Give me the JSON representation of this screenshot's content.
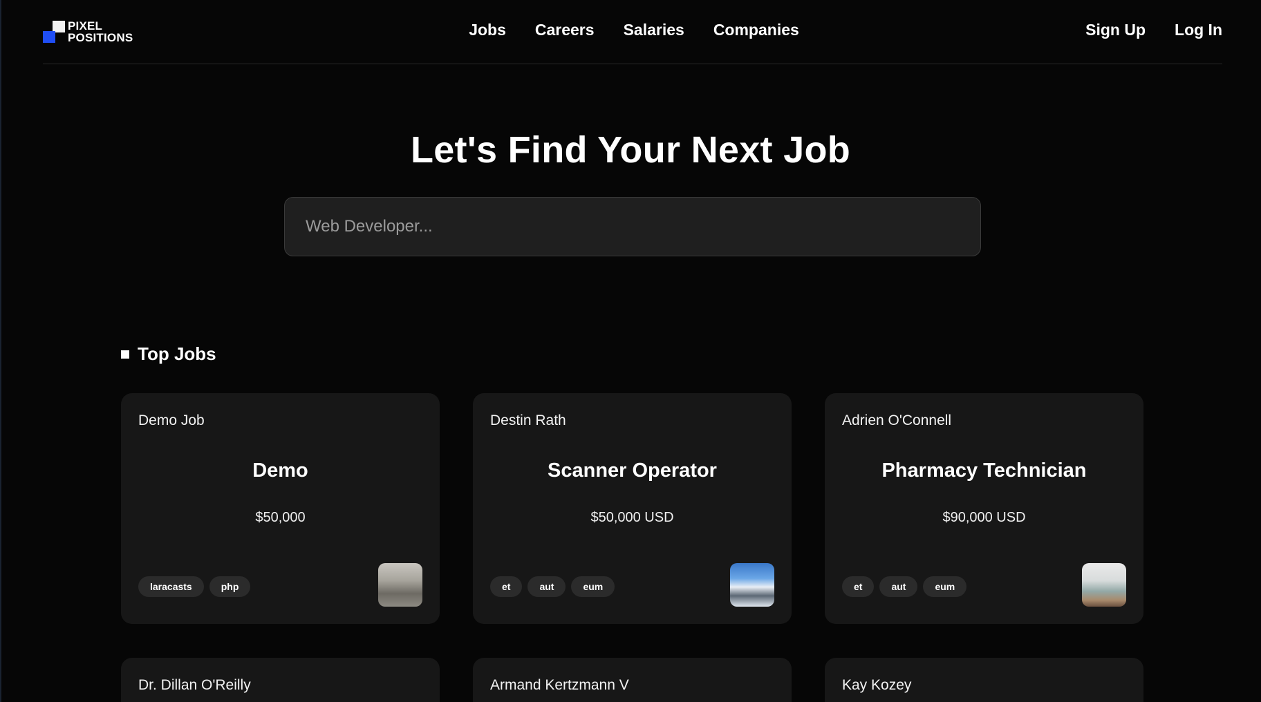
{
  "brand": {
    "name": "PIXEL\nPOSITIONS"
  },
  "nav": {
    "items": [
      "Jobs",
      "Careers",
      "Salaries",
      "Companies"
    ]
  },
  "auth": {
    "signup": "Sign Up",
    "login": "Log In"
  },
  "hero": {
    "title": "Let's Find Your Next Job",
    "search_placeholder": "Web Developer..."
  },
  "top_jobs": {
    "heading": "Top Jobs",
    "cards": [
      {
        "employer": "Demo Job",
        "title": "Demo",
        "salary": "$50,000",
        "tags": [
          "laracasts",
          "php"
        ],
        "thumb": "gray-landscape"
      },
      {
        "employer": "Destin Rath",
        "title": "Scanner Operator",
        "salary": "$50,000 USD",
        "tags": [
          "et",
          "aut",
          "eum"
        ],
        "thumb": "snowy-mountain"
      },
      {
        "employer": "Adrien O'Connell",
        "title": "Pharmacy Technician",
        "salary": "$90,000 USD",
        "tags": [
          "et",
          "aut",
          "eum"
        ],
        "thumb": "misty-coast"
      }
    ]
  },
  "more_jobs": {
    "cards": [
      {
        "employer": "Dr. Dillan O'Reilly"
      },
      {
        "employer": "Armand Kertzmann V"
      },
      {
        "employer": "Kay Kozey"
      }
    ]
  },
  "colors": {
    "background": "#060606",
    "card": "#171717",
    "tag": "#2b2b2b",
    "brand_blue": "#1f4ef5"
  }
}
